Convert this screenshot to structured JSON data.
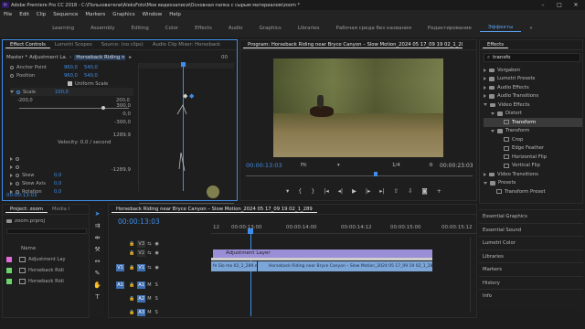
{
  "window": {
    "title": "Adobe Premiere Pro CC 2018 - C:\\Пользователи\\AleksFoto\\Мои видеозаписи\\Основная папка с сырым материалом\\zoom *",
    "app_badge": "Pr",
    "controls": [
      "–",
      "□",
      "✕"
    ]
  },
  "menu": [
    "File",
    "Edit",
    "Clip",
    "Sequence",
    "Markers",
    "Graphics",
    "Window",
    "Help"
  ],
  "workspaces": {
    "tabs": [
      "Learning",
      "Assembly",
      "Editing",
      "Color",
      "Effects",
      "Audio",
      "Graphics",
      "Libraries",
      "Рабочая среда без названия",
      "Редактирование",
      "Эффекты"
    ],
    "active": "Эффекты",
    "more": "»"
  },
  "effect_controls": {
    "tabs": [
      "Effect Controls",
      "Lumetri Scopes",
      "Source: (no clips)",
      "Audio Clip Mixer: Horseback"
    ],
    "menu_icon": "≡",
    "master": "Master * Adjustment La...",
    "clip": "Horseback Riding n...",
    "timecode_short": "00",
    "rows": [
      {
        "label": "Anchor Point",
        "v1": "960,0",
        "v2": "540,0"
      },
      {
        "label": "Position",
        "v1": "960,0",
        "v2": "540,0"
      },
      {
        "label": "Uniform Scale"
      },
      {
        "label": "Scale",
        "v1": "100,0"
      },
      {
        "label": "-200,0",
        "v1": "200,0"
      }
    ],
    "graph": {
      "top": "300,0",
      "mid": "0,0",
      "low": "-300,0",
      "low2": "1289,9",
      "bottom": "-1289,9",
      "velocity": "Velocity: 0,0 / second"
    },
    "extra_rows": [
      {
        "label": "Skew",
        "v1": "0,0"
      },
      {
        "label": "Skew Axis",
        "v1": "0,0"
      },
      {
        "label": "Rotation",
        "v1": "0,0"
      }
    ],
    "timecode": "00:00:13:03"
  },
  "program": {
    "title": "Program: Horseback Riding near Bryce Canyon – Slow Motion_2024 05 17_09 19 02_1_289",
    "menu_icon": "≡",
    "timecode": "00:00:13:03",
    "fit": "Fit",
    "fraction": "1/4",
    "duration": "00:00:23:03"
  },
  "effects": {
    "tab": "Effects",
    "search": "transfo",
    "items": [
      {
        "label": "Vorgaben",
        "level": 0,
        "kind": "folder",
        "open": false
      },
      {
        "label": "Lumetri Presets",
        "level": 0,
        "kind": "folder",
        "open": false
      },
      {
        "label": "Audio Effects",
        "level": 0,
        "kind": "folder",
        "open": false
      },
      {
        "label": "Audio Transitions",
        "level": 0,
        "kind": "folder",
        "open": false
      },
      {
        "label": "Video Effects",
        "level": 0,
        "kind": "folder",
        "open": true
      },
      {
        "label": "Distort",
        "level": 1,
        "kind": "folder",
        "open": true
      },
      {
        "label": "Transform",
        "level": 2,
        "kind": "fx",
        "selected": true
      },
      {
        "label": "Transform",
        "level": 1,
        "kind": "folder",
        "open": true
      },
      {
        "label": "Crop",
        "level": 2,
        "kind": "fx"
      },
      {
        "label": "Edge Feather",
        "level": 2,
        "kind": "fx"
      },
      {
        "label": "Horizontal Flip",
        "level": 2,
        "kind": "fx"
      },
      {
        "label": "Vertical Flip",
        "level": 2,
        "kind": "fx"
      },
      {
        "label": "Video Transitions",
        "level": 0,
        "kind": "folder",
        "open": false
      },
      {
        "label": "Presets",
        "level": 0,
        "kind": "folder",
        "open": true
      },
      {
        "label": "Transform Preset",
        "level": 1,
        "kind": "fx"
      }
    ],
    "side_panels": [
      "Essential Graphics",
      "Essential Sound",
      "Lumetri Color",
      "Libraries",
      "Markers",
      "History",
      "Info"
    ]
  },
  "project": {
    "tabs": [
      "Project: zoom",
      "Media I"
    ],
    "file": "zoom.prproj",
    "column": "Name",
    "items": [
      {
        "name": "Adjustment Lay",
        "color": "#e06ad8"
      },
      {
        "name": "Horseback Ridi",
        "color": "#6bd36b"
      },
      {
        "name": "Horseback Ridi",
        "color": "#6bd36b"
      }
    ]
  },
  "timeline": {
    "tab": "Horseback Riding near Bryce Canyon – Slow Motion_2024 05 17_09 19 02_1_289",
    "timecode": "00:00:13:03",
    "ruler": [
      "12",
      "00:00:13:00",
      "00:00:14:00",
      "00:00:14:12",
      "00:00:15:00",
      "00:00:15:12"
    ],
    "video_tracks": [
      "V3",
      "V2",
      "V1"
    ],
    "audio_tracks": [
      "A1",
      "A2",
      "A3"
    ],
    "source_v": "V1",
    "source_a": "A1",
    "clips": {
      "adjustment": "Adjustment Layer",
      "v1_left": "fe Slo mo 02_1_289.mp4",
      "v1_right": "Horseback Riding near Bryce Canyon – Slow Motion_2024 05 17_09 19 02_1_289.mp4"
    }
  },
  "colors": {
    "accent": "#3f8de8",
    "adjustment": "#9a8fd6",
    "video_clip": "#7da6d8",
    "selection": "#3f6fb0"
  }
}
